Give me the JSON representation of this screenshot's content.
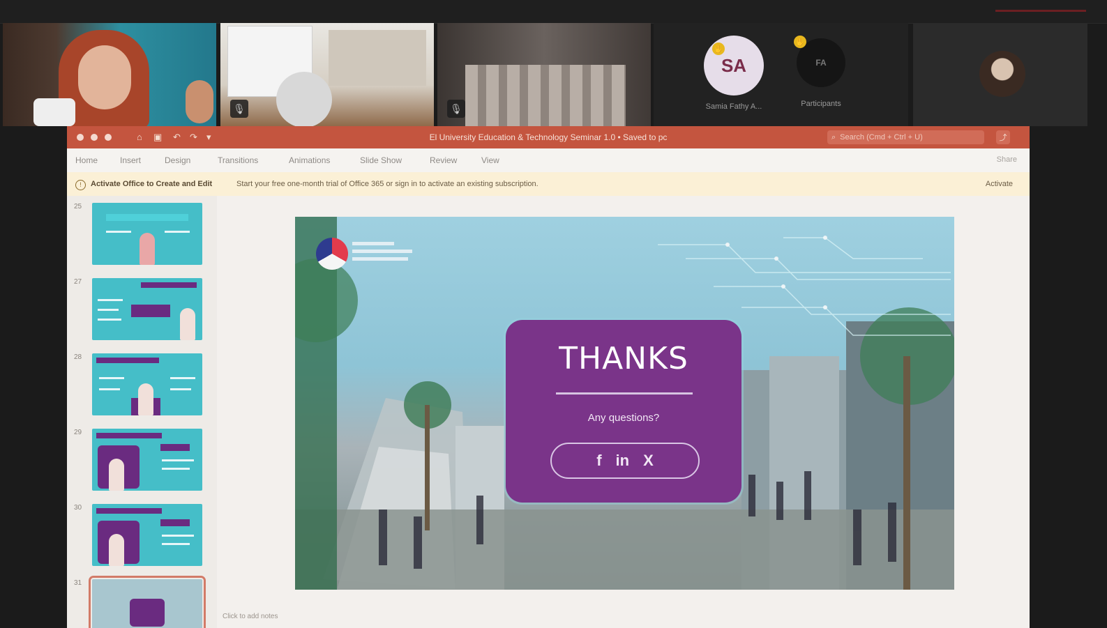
{
  "meeting": {
    "participants": [
      {
        "name": "",
        "type": "video"
      },
      {
        "name": "",
        "type": "video"
      },
      {
        "name": "",
        "type": "video"
      },
      {
        "name": "Samia Fathy A...",
        "initials": "SA",
        "type": "avatar",
        "raised_hand": true
      },
      {
        "name": "Participants",
        "initials": "FA",
        "type": "avatar",
        "raised_hand": true
      },
      {
        "name": "",
        "type": "avatar-photo"
      }
    ],
    "colors": {
      "avatar_sa_bg": "#e6dde9",
      "avatar_sa_text": "#7a2c4a",
      "avatar_fa_bg": "#151515"
    }
  },
  "powerpoint": {
    "title": "El University Education & Technology Seminar 1.0 • Saved to pc",
    "search_placeholder": "Search (Cmd + Ctrl + U)",
    "share_label": "⤴",
    "ribbon_tabs": [
      "Home",
      "Insert",
      "Design",
      "Transitions",
      "Animations",
      "Slide Show",
      "Review",
      "View"
    ],
    "ribbon_right": "Share",
    "notice": {
      "bold": "Activate Office to Create and Edit",
      "message": "Start your free one-month trial of Office 365 or sign in to activate an existing subscription.",
      "action": "Activate"
    },
    "thumbnails": [
      {
        "number": "25"
      },
      {
        "number": "27"
      },
      {
        "number": "28"
      },
      {
        "number": "29"
      },
      {
        "number": "30"
      },
      {
        "number": "31",
        "selected": true
      }
    ],
    "slide": {
      "title": "THANKS",
      "subtitle": "Any questions?",
      "social": [
        "f",
        "in",
        "X"
      ]
    },
    "notes_label": "Click to add notes"
  }
}
